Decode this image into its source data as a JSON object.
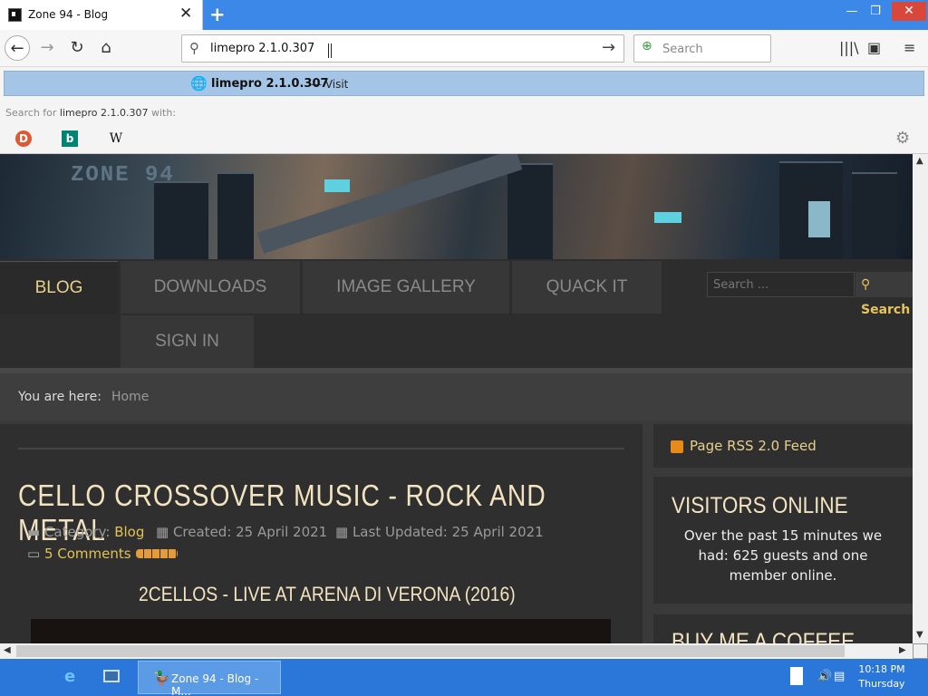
{
  "browser": {
    "tab_title": "Zone 94 - Blog",
    "url_value": "limepro 2.1.0.307",
    "search_placeholder": "Search",
    "suggestion": {
      "text": "limepro 2.1.0.307",
      "action": "— Visit"
    },
    "search_for_prefix": "Search for",
    "search_for_query": "limepro 2.1.0.307",
    "search_for_suffix": "with:",
    "engines": [
      {
        "name": "duckduckgo-icon",
        "glyph": "D"
      },
      {
        "name": "bing-icon",
        "glyph": "b"
      },
      {
        "name": "wikipedia-icon",
        "glyph": "W"
      }
    ]
  },
  "site": {
    "logo_text": "ZONE 94",
    "nav": [
      "BLOG",
      "DOWNLOADS",
      "IMAGE GALLERY",
      "QUACK IT",
      "SIGN IN"
    ],
    "search_placeholder": "Search ...",
    "search_button": "Search",
    "breadcrumb_label": "You are here:",
    "breadcrumb_home": "Home"
  },
  "article": {
    "title": "CELLO CROSSOVER MUSIC - ROCK AND METAL",
    "category_label": "Category:",
    "category": "Blog",
    "created": "Created: 25 April 2021",
    "updated": "Last Updated: 25 April 2021",
    "comments": "5 Comments",
    "subtitle": "2CELLOS - LIVE AT ARENA DI VERONA (2016)"
  },
  "sidebar": {
    "rss": "Page RSS 2.0 Feed",
    "visitors_heading": "VISITORS ONLINE",
    "visitors_text": "Over the past 15 minutes we had: 625 guests and one member online.",
    "coffee_heading": "BUY ME A COFFEE"
  },
  "taskbar": {
    "task_label": "Zone 94 - Blog - M...",
    "time": "10:18 PM",
    "day": "Thursday"
  },
  "colors": {
    "accent": "#e8d08c",
    "link": "#e2c256",
    "titlebar": "#3b88e8",
    "taskbar": "#2a76d9"
  }
}
